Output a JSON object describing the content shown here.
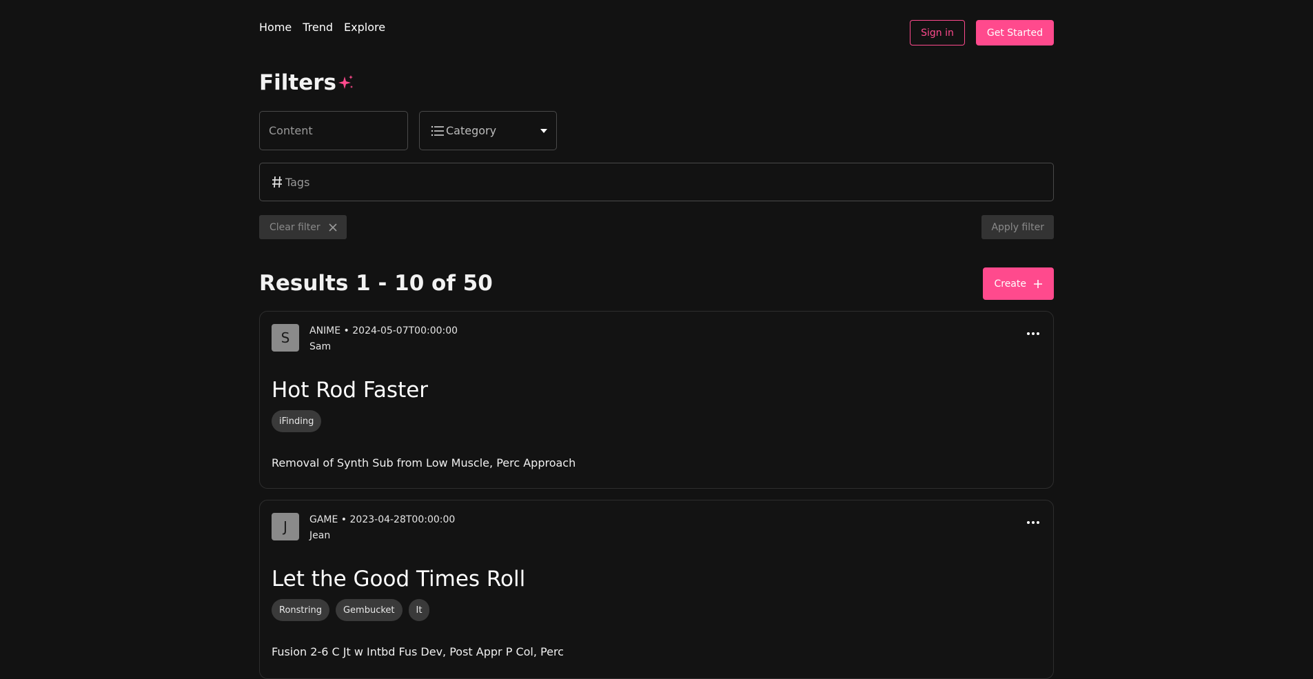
{
  "nav": {
    "home": "Home",
    "trend": "Trend",
    "explore": "Explore"
  },
  "header": {
    "sign_in": "Sign in",
    "get_started": "Get Started"
  },
  "filters": {
    "title": "Filters",
    "content_placeholder": "Content",
    "category_placeholder": "Category",
    "tags_placeholder": "Tags",
    "clear_label": "Clear filter",
    "apply_label": "Apply filter"
  },
  "results": {
    "title": "Results 1 - 10 of 50",
    "create_label": "Create"
  },
  "posts": [
    {
      "avatar_initial": "S",
      "meta": "ANIME • 2024-05-07T00:00:00",
      "author": "Sam",
      "title": "Hot Rod Faster",
      "tags": [
        "iFinding"
      ],
      "description": "Removal of Synth Sub from Low Muscle, Perc Approach"
    },
    {
      "avatar_initial": "J",
      "meta": "GAME • 2023-04-28T00:00:00",
      "author": "Jean",
      "title": "Let the Good Times Roll",
      "tags": [
        "Ronstring",
        "Gembucket",
        "It"
      ],
      "description": "Fusion 2-6 C Jt w Intbd Fus Dev, Post Appr P Col, Perc"
    }
  ],
  "colors": {
    "background": "#121212",
    "accent": "#ff4a8d",
    "muted_button": "#333333",
    "tag_bg": "#3a3a3a",
    "avatar_bg": "#8a8a8a"
  }
}
